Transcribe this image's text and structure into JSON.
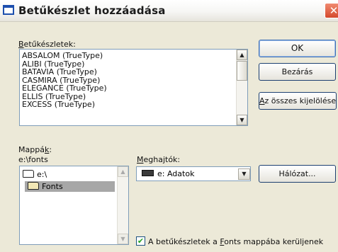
{
  "window": {
    "title": "Betűkészlet hozzáadása",
    "close_glyph": "✕"
  },
  "fonts_section": {
    "label_accel": "B",
    "label_rest": "etűkészletek:",
    "items": [
      "ABSALOM (TrueType)",
      "ALIBI (TrueType)",
      "BATAVIA (TrueType)",
      "CASMIRA (TrueType)",
      "ELEGANCE (TrueType)",
      "ELLIS (TrueType)",
      "EXCESS (TrueType)"
    ]
  },
  "buttons": {
    "ok": "OK",
    "close": "Bezárás",
    "select_all_accel": "A",
    "select_all_rest": "z összes kijelölése",
    "network": "Hálózat..."
  },
  "folders_section": {
    "label_start": "Mappá",
    "label_accel": "k",
    "label_end": ":",
    "current_path": "e:\\fonts",
    "tree": [
      {
        "name": "e:\\",
        "icon": "open-folder-icon"
      },
      {
        "name": "Fonts",
        "icon": "open-folder-icon",
        "selected": true
      }
    ]
  },
  "drives_section": {
    "label_accel": "M",
    "label_rest": "eghajtók:",
    "selected": "e: Adatok",
    "icon": "hard-drive-icon"
  },
  "copy_option": {
    "checked": true,
    "label_start": "A betűkészletek a ",
    "label_accel": "F",
    "label_end": "onts mappába kerüljenek"
  },
  "glyphs": {
    "scroll_up": "▲",
    "scroll_down": "▼",
    "check": "✔"
  },
  "colors": {
    "dialog_bg": "#ece9d8",
    "close_button": "#d4492c",
    "selection": "#a7a7a7"
  }
}
